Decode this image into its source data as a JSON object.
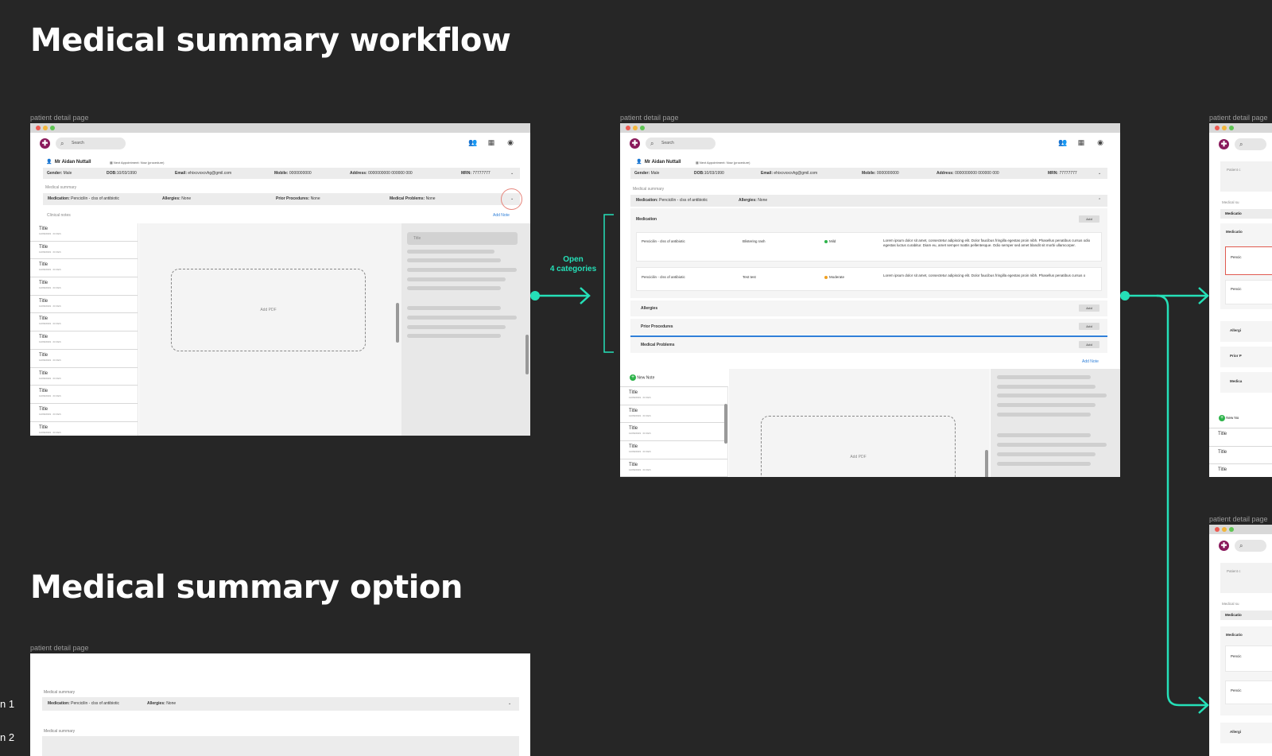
{
  "titles": {
    "workflow": "Medical summary workflow",
    "option": "Medical summary option"
  },
  "frame_label": "patient detail page",
  "patient": {
    "name": "Mr Aidan Nuttall",
    "appointment": "Next Appointment: Now (procedure)",
    "gender_label": "Gender:",
    "gender": "Male",
    "dob_label": "DOB:",
    "dob": "10/03/1990",
    "email_label": "Email:",
    "email": "ehixcvxxcvhg@gmil.com",
    "mobile_label": "Mobile:",
    "mobile": "0000000000",
    "address_label": "Address:",
    "address": "0000000000 000000 000",
    "mrn_label": "MRN:",
    "mrn": "77777777"
  },
  "search_placeholder": "Search",
  "summary": {
    "label": "Medical summary",
    "medication_label": "Medication:",
    "medication": "Pencicilin - clss of antibiotic",
    "allergies_label": "Allergies:",
    "allergies": "None",
    "procedures_label": "Prior Procedures:",
    "procedures": "None",
    "problems_label": "Medical Problems:",
    "problems": "None"
  },
  "clinical_notes": "Clinical notes",
  "add_note": "Add Note",
  "new_note": "New Note",
  "note_title": "Title",
  "note_meta": "12/06/2019 · Dr Rich",
  "add_pdf": "Add PDF",
  "side_title": "Title",
  "categories": {
    "medication": "Medication",
    "allergies": "Allergies",
    "procedures": "Prior Procedures",
    "problems": "Medical Problems",
    "add": "Add"
  },
  "med_rows": [
    {
      "drug": "Pencicilin - clss of antibiotic",
      "reaction": "Blistering rash",
      "severity": "Mild",
      "severity_color": "#2db34a",
      "note": "Lorem ipsum dolor sit amet, consectetur adipiscing elit. Dolor faucibus fringilla egestas proin nibh. Phasellus penatibus cursus odio egestas luctus curabitur. Diam eu, amet semper mattis pellentesque. Odio semper sed amet blandit sit morbi ullamcorper."
    },
    {
      "drug": "Pencicilin - clss of antibiotic",
      "reaction": "Test test",
      "severity": "Moderate",
      "severity_color": "#f0a020",
      "note": "Lorem ipsum dolor sit amet, consectetur adipiscing elit. Dolor faucibus fringilla egestas proin nibh. Phasellus penatibus cursus o"
    }
  ],
  "arrow_label": "Open\n4 categories",
  "right_fragments": {
    "patient": "Patient c",
    "summary": "Medical su",
    "medication": "Medicatio",
    "pencil": "Pencic",
    "allergies": "Allergi",
    "prior": "Prior P",
    "medica": "Medica",
    "newnote": "New No",
    "title": "Title"
  },
  "left_edge": {
    "a": "n 1",
    "b": "n 2"
  },
  "accent": "#25e0b8"
}
